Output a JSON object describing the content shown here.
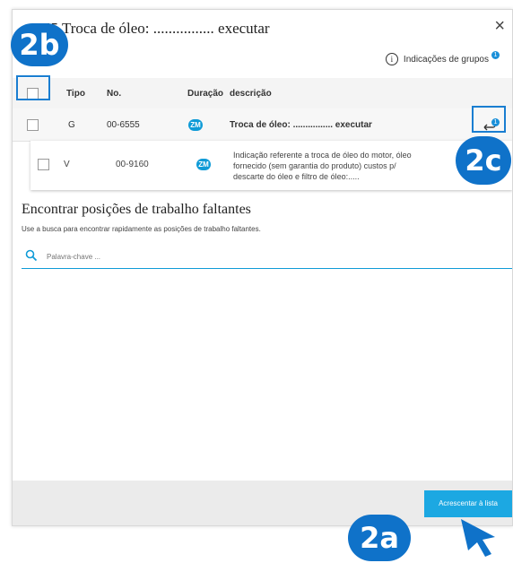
{
  "dialog": {
    "title": "55 Troca de óleo: ................ executar",
    "close_label": "×",
    "group_hints_label": "Indicações de grupos",
    "group_hints_count": "1",
    "info_symbol": "i"
  },
  "table": {
    "headers": {
      "type": "Tipo",
      "number": "No.",
      "duration": "Duração",
      "description": "descrição"
    },
    "rows": [
      {
        "type": "G",
        "number": "00-6555",
        "duration_badge": "ZM",
        "description": "Troca de óleo: ................ executar",
        "action_badge": "1"
      },
      {
        "type": "V",
        "number": "00-9160",
        "duration_badge": "ZM",
        "description": "Indicação referente a troca de óleo do motor, óleo fornecido (sem garantia do produto) custos p/ descarte do óleo e filtro de óleo:....."
      }
    ]
  },
  "search_section": {
    "title": "Encontrar posições de trabalho faltantes",
    "subtitle": "Use a busca para encontrar rapidamente as posições de trabalho faltantes.",
    "placeholder": "Palavra-chave ..."
  },
  "footer": {
    "add_button_label": "Acrescentar à lista"
  },
  "callouts": {
    "a": "2a",
    "b": "2b",
    "c": "2c"
  },
  "colors": {
    "accent": "#1ca8e2",
    "callout": "#0f72c9",
    "badge": "#0f9bd7"
  },
  "icons": [
    "close-icon",
    "info-icon",
    "search-icon",
    "assign-arrow-icon",
    "cursor-arrow-icon"
  ]
}
